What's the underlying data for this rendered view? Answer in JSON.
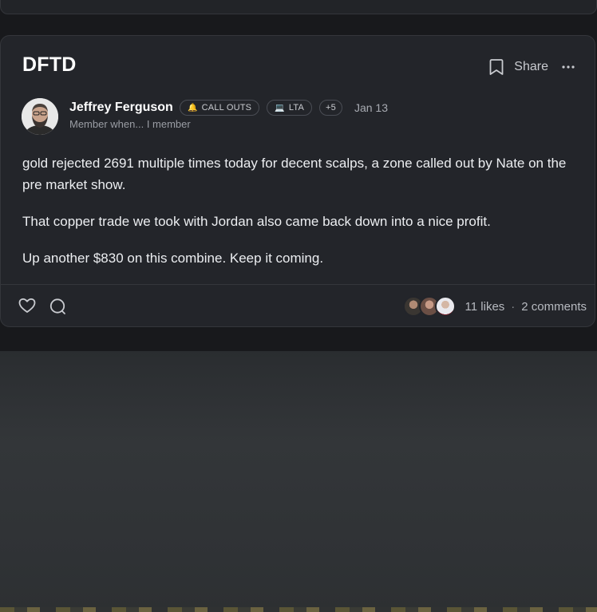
{
  "post": {
    "title": "DFTD",
    "actions": {
      "share_label": "Share"
    },
    "author": {
      "name": "Jeffrey Ferguson",
      "subtitle": "Member when... I member"
    },
    "badges": [
      {
        "emoji": "🔔",
        "label": "CALL OUTS"
      },
      {
        "emoji": "💻",
        "label": "LTA"
      },
      {
        "label": "+5"
      }
    ],
    "date": "Jan 13",
    "body": [
      "gold rejected 2691 multiple times today for decent scalps, a zone called out by Nate on the pre market show.",
      "That copper trade we took with Jordan also came back down into a nice profit.",
      "Up another $830 on this combine. Keep it coming."
    ],
    "footer": {
      "likes": "11 likes",
      "separator": "·",
      "comments": "2 comments"
    }
  },
  "colors": {
    "background": "#18191c",
    "card": "#23252a",
    "border": "#34363b",
    "text": "#e6e7ea",
    "muted": "#9a9da4"
  },
  "icons": {
    "bookmark": "bookmark-icon",
    "more": "more-horizontal-icon",
    "like": "heart-icon",
    "comment": "comment-bubble-icon"
  }
}
